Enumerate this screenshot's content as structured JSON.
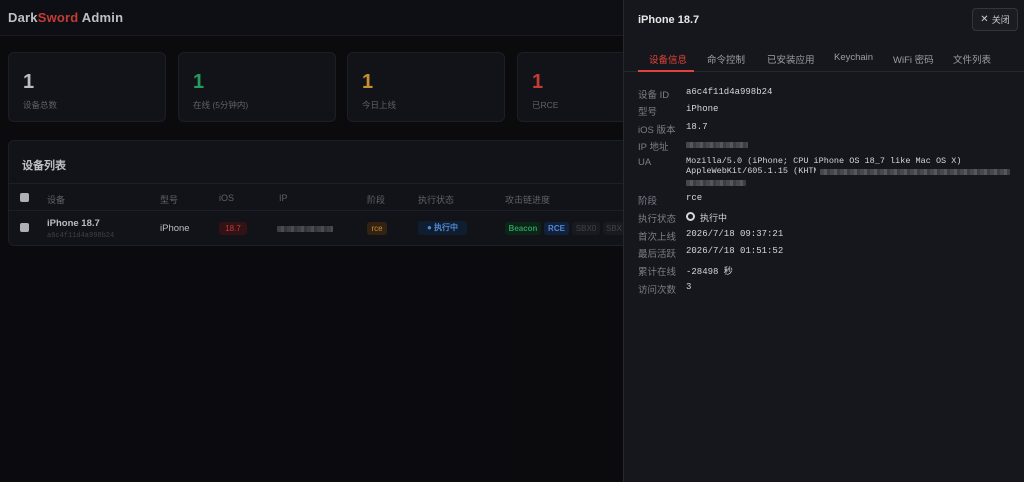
{
  "brand": {
    "part1": "Dark",
    "part2": "Sword",
    "part3": " Admin"
  },
  "stats": [
    {
      "value": "1",
      "label": "设备总数",
      "color": "#d6d8dc"
    },
    {
      "value": "1",
      "label": "在线 (5分钟内)",
      "color": "#2fb06a"
    },
    {
      "value": "1",
      "label": "今日上线",
      "color": "#e3a33a"
    },
    {
      "value": "1",
      "label": "已RCE",
      "color": "#e0433d"
    }
  ],
  "device_list": {
    "title": "设备列表",
    "columns": [
      "设备",
      "型号",
      "iOS",
      "IP",
      "阶段",
      "执行状态",
      "攻击链进度"
    ],
    "rows": [
      {
        "name": "iPhone 18.7",
        "id": "a6c4f11d4a998b24",
        "model": "iPhone",
        "ios": "18.7",
        "stage": "rce",
        "exec_status": "● 执行中",
        "chain": [
          "Beacon",
          "RCE",
          "SBX0",
          "SBX"
        ]
      }
    ]
  },
  "drawer": {
    "title": "iPhone 18.7",
    "close_label": "关闭",
    "tabs": [
      "设备信息",
      "命令控制",
      "已安装应用",
      "Keychain",
      "WiFi 密码",
      "文件列表"
    ],
    "active_tab": 0,
    "fields": {
      "device_id_label": "设备 ID",
      "device_id": "a6c4f11d4a998b24",
      "model_label": "型号",
      "model": "iPhone",
      "ios_label": "iOS 版本",
      "ios": "18.7",
      "ip_label": "IP 地址",
      "ua_label": "UA",
      "ua_line1": "Mozilla/5.0 (iPhone; CPU iPhone OS 18_7 like Mac OS X)",
      "ua_line2": "AppleWebKit/605.1.15 (KHTML",
      "stage_label": "阶段",
      "stage": "rce",
      "exec_label": "执行状态",
      "exec": "执行中",
      "first_label": "首次上线",
      "first": "2026/7/18 09:37:21",
      "last_label": "最后活跃",
      "last": "2026/7/18 01:51:52",
      "online_label": "累计在线",
      "online": "-28498 秒",
      "visits_label": "访问次数",
      "visits": "3"
    }
  },
  "colors": {
    "accent": "#e0433d",
    "success": "#2fb06a",
    "warning": "#e3a33a",
    "info": "#3d7fe0"
  }
}
